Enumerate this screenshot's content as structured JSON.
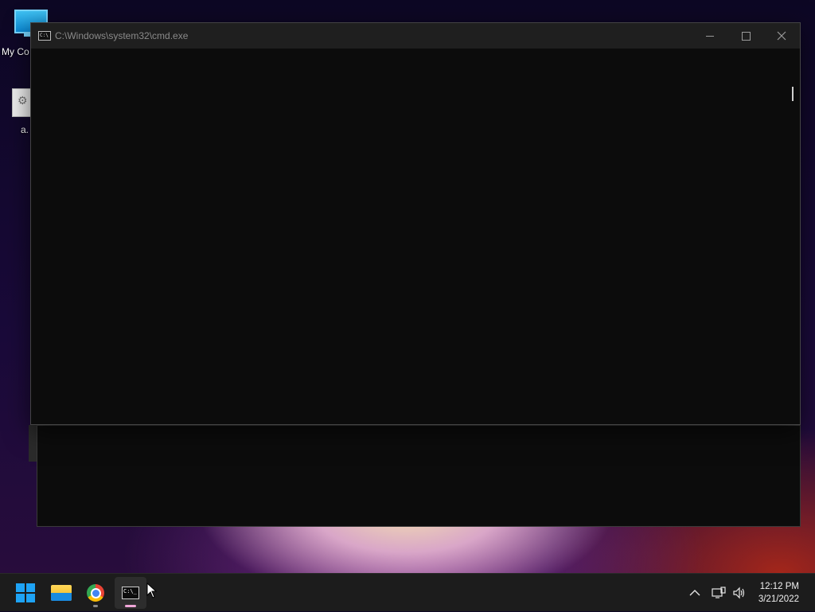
{
  "desktop": {
    "icons": [
      {
        "label": "My Co",
        "icon": "monitor-icon"
      },
      {
        "label": "a.",
        "icon": "file-icon"
      }
    ]
  },
  "cmd_window": {
    "title": "C:\\Windows\\system32\\cmd.exe",
    "icon": "cmd-icon",
    "controls": {
      "minimize": "minimize-icon",
      "maximize": "maximize-icon",
      "close": "close-icon"
    }
  },
  "taskbar": {
    "apps": [
      {
        "name": "start",
        "icon": "windows-logo-icon"
      },
      {
        "name": "file-explorer",
        "icon": "folder-icon"
      },
      {
        "name": "chrome",
        "icon": "chrome-icon"
      },
      {
        "name": "command-prompt",
        "icon": "cmd-icon",
        "active": true
      }
    ],
    "tray": {
      "icons": [
        "chevron-up-icon",
        "network-icon",
        "volume-icon"
      ]
    },
    "clock": {
      "time": "12:12 PM",
      "date": "3/21/2022"
    },
    "colors": {
      "accent": "#1ea3f5",
      "active_indicator": "#f0a6d8",
      "inactive_indicator": "#8a8a8a"
    }
  }
}
